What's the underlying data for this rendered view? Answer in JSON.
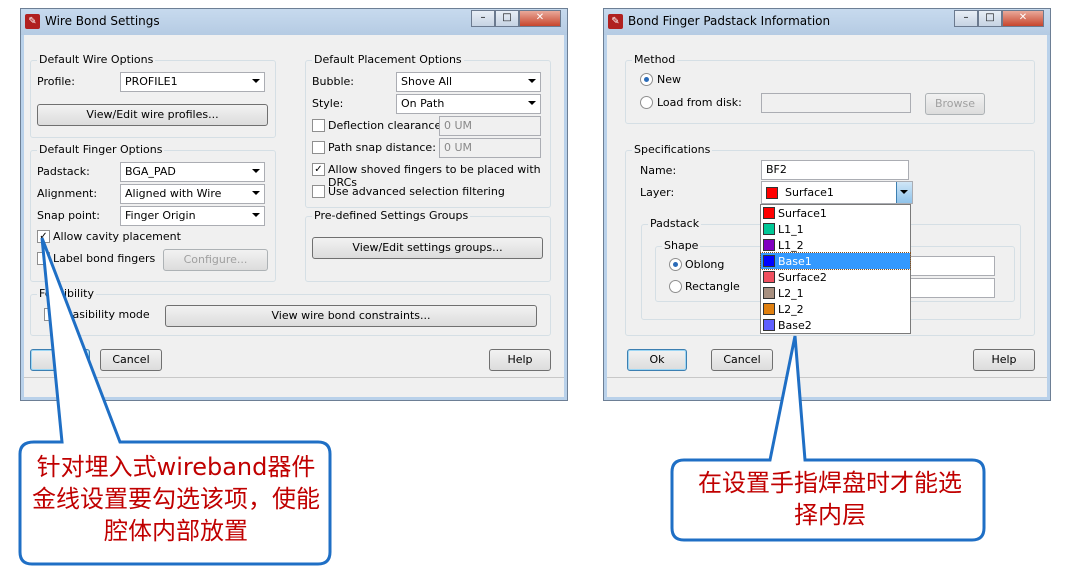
{
  "wire_bond": {
    "title": "Wire Bond Settings",
    "wire_options": {
      "label": "Default Wire Options",
      "profile_label": "Profile:",
      "profile_value": "PROFILE1",
      "view_profiles": "View/Edit wire profiles..."
    },
    "finger_options": {
      "label": "Default Finger Options",
      "padstack_label": "Padstack:",
      "padstack_value": "BGA_PAD",
      "alignment_label": "Alignment:",
      "alignment_value": "Aligned with Wire",
      "snap_label": "Snap point:",
      "snap_value": "Finger Origin",
      "allow_cavity": "Allow cavity placement",
      "allow_cavity_checked": true,
      "label_fingers": "Label bond fingers",
      "label_fingers_checked": false,
      "configure": "Configure..."
    },
    "placement": {
      "label": "Default Placement Options",
      "bubble_label": "Bubble:",
      "bubble_value": "Shove All",
      "style_label": "Style:",
      "style_value": "On Path",
      "deflection": "Deflection clearance:",
      "deflection_value": "0 UM",
      "path_snap": "Path snap distance:",
      "path_snap_value": "0 UM",
      "allow_shoved": "Allow shoved fingers to be placed with DRCs",
      "allow_shoved_checked": true,
      "advanced": "Use advanced selection filtering",
      "advanced_checked": false
    },
    "predefined": {
      "label": "Pre-defined Settings Groups",
      "button": "View/Edit settings groups..."
    },
    "feasibility": {
      "label": "Feasibility",
      "mode": "Feasibility mode",
      "mode_checked": false,
      "view_constraints": "View wire bond constraints..."
    },
    "ok": "OK",
    "cancel": "Cancel",
    "help": "Help"
  },
  "padstack_info": {
    "title": "Bond Finger Padstack Information",
    "method": {
      "label": "Method",
      "new": "New",
      "new_selected": true,
      "load": "Load from disk:",
      "browse": "Browse"
    },
    "spec": {
      "label": "Specifications",
      "name_label": "Name:",
      "name_value": "BF2",
      "layer_label": "Layer:",
      "layer_value": "Surface1",
      "layer_color": "#ff0000"
    },
    "padstack": {
      "label": "Padstack",
      "shape_label": "Shape",
      "oblong": "Oblong",
      "oblong_selected": true,
      "rectangle": "Rectangle"
    },
    "layers": [
      {
        "name": "Surface1",
        "color": "#ff0000"
      },
      {
        "name": "L1_1",
        "color": "#00c896"
      },
      {
        "name": "L1_2",
        "color": "#8000c0"
      },
      {
        "name": "Base1",
        "color": "#0000ff",
        "selected": true
      },
      {
        "name": "Surface2",
        "color": "#f05060"
      },
      {
        "name": "L2_1",
        "color": "#a89080"
      },
      {
        "name": "L2_2",
        "color": "#e08010"
      },
      {
        "name": "Base2",
        "color": "#6060ff"
      }
    ],
    "ok": "Ok",
    "cancel": "Cancel",
    "help": "Help"
  },
  "callouts": {
    "left": "针对埋入式wireband器件金线设置要勾选该项，使能腔体内部放置",
    "right": "在设置手指焊盘时才能选择内层",
    "border_color": "#1f6fc5",
    "text_color": "#c00000"
  }
}
